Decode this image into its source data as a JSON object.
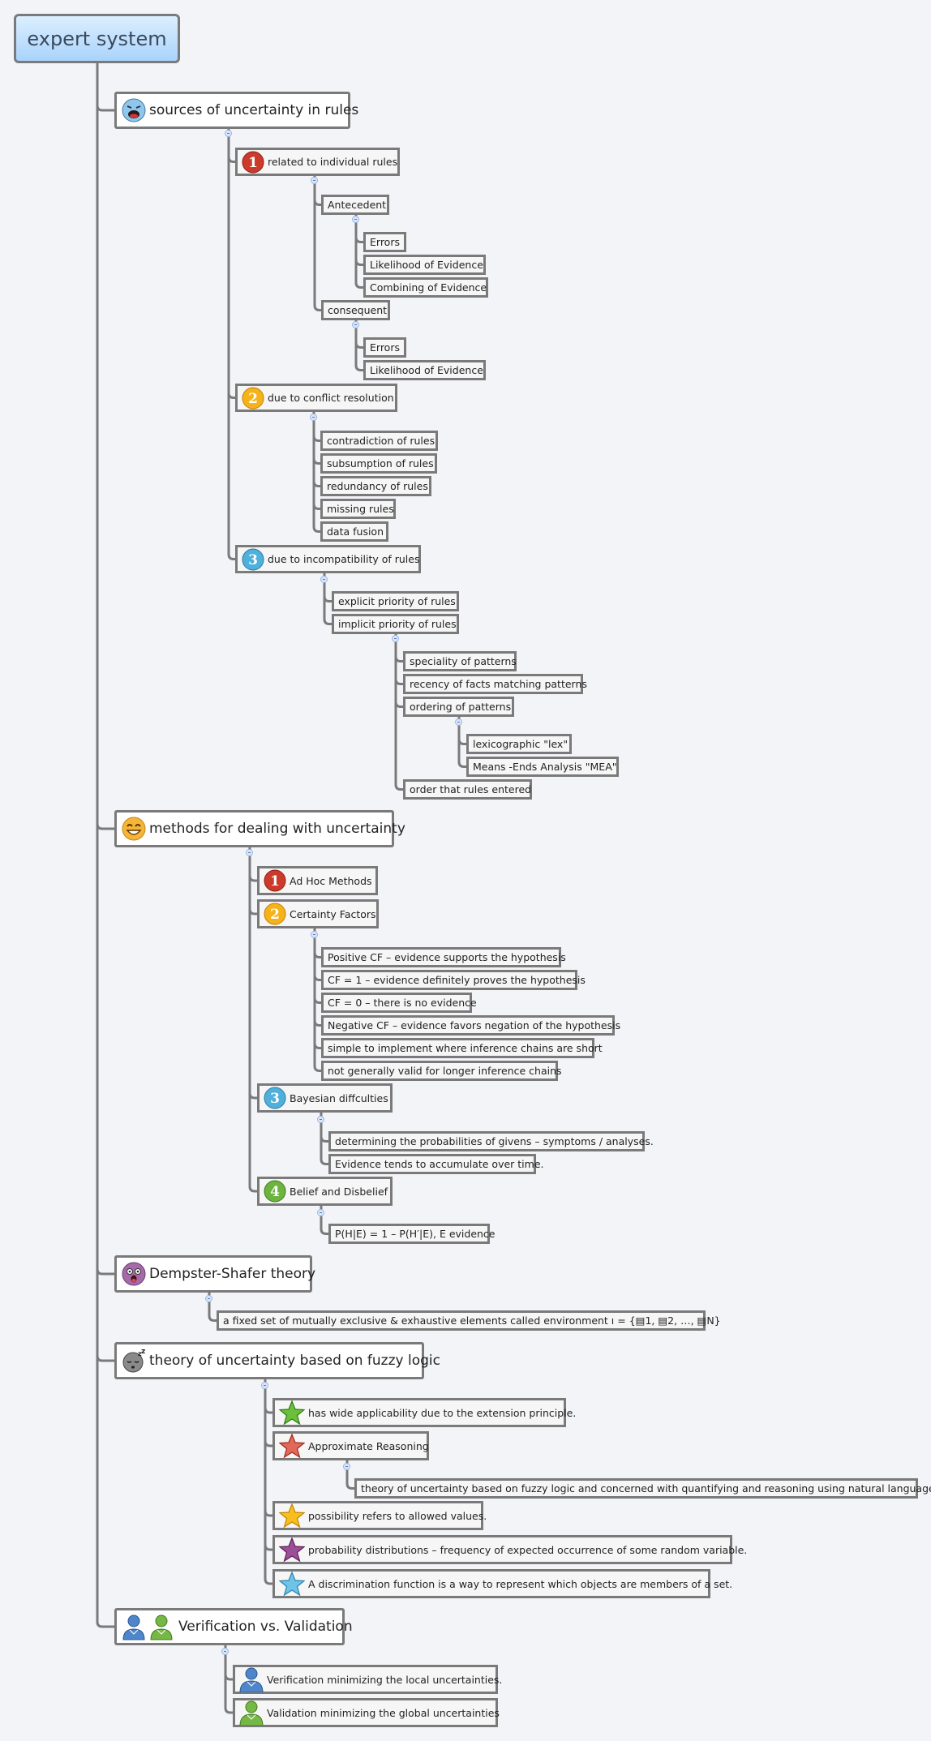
{
  "title": "expert system",
  "colors": {
    "line": "#7a7a7a",
    "root_top": "#dcefff",
    "root_bottom": "#a9d3fb",
    "background": "#f3f4f8"
  },
  "branches": [
    {
      "label": "sources of uncertainty in rules",
      "icon": "crying-face-icon",
      "children": [
        {
          "label": "related to individual rules",
          "icon": "priority-1-icon",
          "children": [
            {
              "label": "Antecedent",
              "children": [
                {
                  "label": "Errors"
                },
                {
                  "label": "Likelihood of Evidence"
                },
                {
                  "label": "Combining of Evidence"
                }
              ]
            },
            {
              "label": "consequent",
              "children": [
                {
                  "label": "Errors"
                },
                {
                  "label": "Likelihood of Evidence"
                }
              ]
            }
          ]
        },
        {
          "label": "due to conflict resolution",
          "icon": "priority-2-icon",
          "children": [
            {
              "label": "contradiction of rules"
            },
            {
              "label": "subsumption of rules"
            },
            {
              "label": "redundancy of rules"
            },
            {
              "label": "missing rules"
            },
            {
              "label": "data fusion"
            }
          ]
        },
        {
          "label": "due to incompatibility of rules",
          "icon": "priority-3-icon",
          "children": [
            {
              "label": "explicit  priority of rules"
            },
            {
              "label": "implicit  priority of rules",
              "children": [
                {
                  "label": "speciality of patterns"
                },
                {
                  "label": "recency of facts matching patterns"
                },
                {
                  "label": "ordering of patterns",
                  "children": [
                    {
                      "label": "lexicographic \"lex\""
                    },
                    {
                      "label": "Means -Ends Analysis \"MEA\""
                    }
                  ]
                },
                {
                  "label": "order that rules entered"
                }
              ]
            }
          ]
        }
      ]
    },
    {
      "label": "methods for dealing with uncertainty",
      "icon": "laughing-face-icon",
      "children": [
        {
          "label": "Ad Hoc Methods",
          "icon": "priority-1-icon"
        },
        {
          "label": "Certainty Factors",
          "icon": "priority-2-icon",
          "children": [
            {
              "label": "Positive CF – evidence supports the hypothesis"
            },
            {
              "label": "CF = 1 – evidence definitely proves the hypothesis"
            },
            {
              "label": "CF = 0 – there is no evidence"
            },
            {
              "label": "Negative CF – evidence favors negation of the hypothesis"
            },
            {
              "label": "simple to implement where inference chains are short"
            },
            {
              "label": "not generally valid for longer inference chains"
            }
          ]
        },
        {
          "label": "Bayesian diffculties",
          "icon": "priority-3-icon",
          "children": [
            {
              "label": "determining the probabilities of  givens – symptoms / analyses."
            },
            {
              "label": "Evidence tends to accumulate over time."
            }
          ]
        },
        {
          "label": "Belief and Disbelief",
          "icon": "priority-4-icon",
          "children": [
            {
              "label": "P(H|E) = 1 – P(H′|E),  E evidence"
            }
          ]
        }
      ]
    },
    {
      "label": "Dempster-Shafer theory",
      "icon": "surprised-face-icon",
      "children": [
        {
          "label": "a fixed set of mutually exclusive & exhaustive elements called environment ı = {▤1, ▤2, …, ▤N}"
        }
      ]
    },
    {
      "label": "theory of uncertainty based on fuzzy logic",
      "icon": "sleeping-face-icon",
      "children": [
        {
          "label": "has wide applicability due to the extension principle.",
          "icon": "green-star-icon"
        },
        {
          "label": "Approximate Reasoning",
          "icon": "red-star-icon",
          "children": [
            {
              "label": "theory of uncertainty based on fuzzy logic and concerned with quantifying and reasoning using natural language"
            }
          ]
        },
        {
          "label": "possibility refers to allowed values.",
          "icon": "yellow-star-icon"
        },
        {
          "label": "probability distributions – frequency of expected occurrence of some random variable.",
          "icon": "purple-star-icon"
        },
        {
          "label": "A discrimination function is a way to represent which objects are members of a set.",
          "icon": "blue-star-icon"
        }
      ]
    },
    {
      "label": "Verification vs. Validation",
      "icon": "two-users-icon",
      "children": [
        {
          "label": "Verification  minimizing the local uncertainties.",
          "icon": "blue-user-icon"
        },
        {
          "label": "Validation  minimizing the global uncertainties",
          "icon": "green-user-icon"
        }
      ]
    }
  ]
}
